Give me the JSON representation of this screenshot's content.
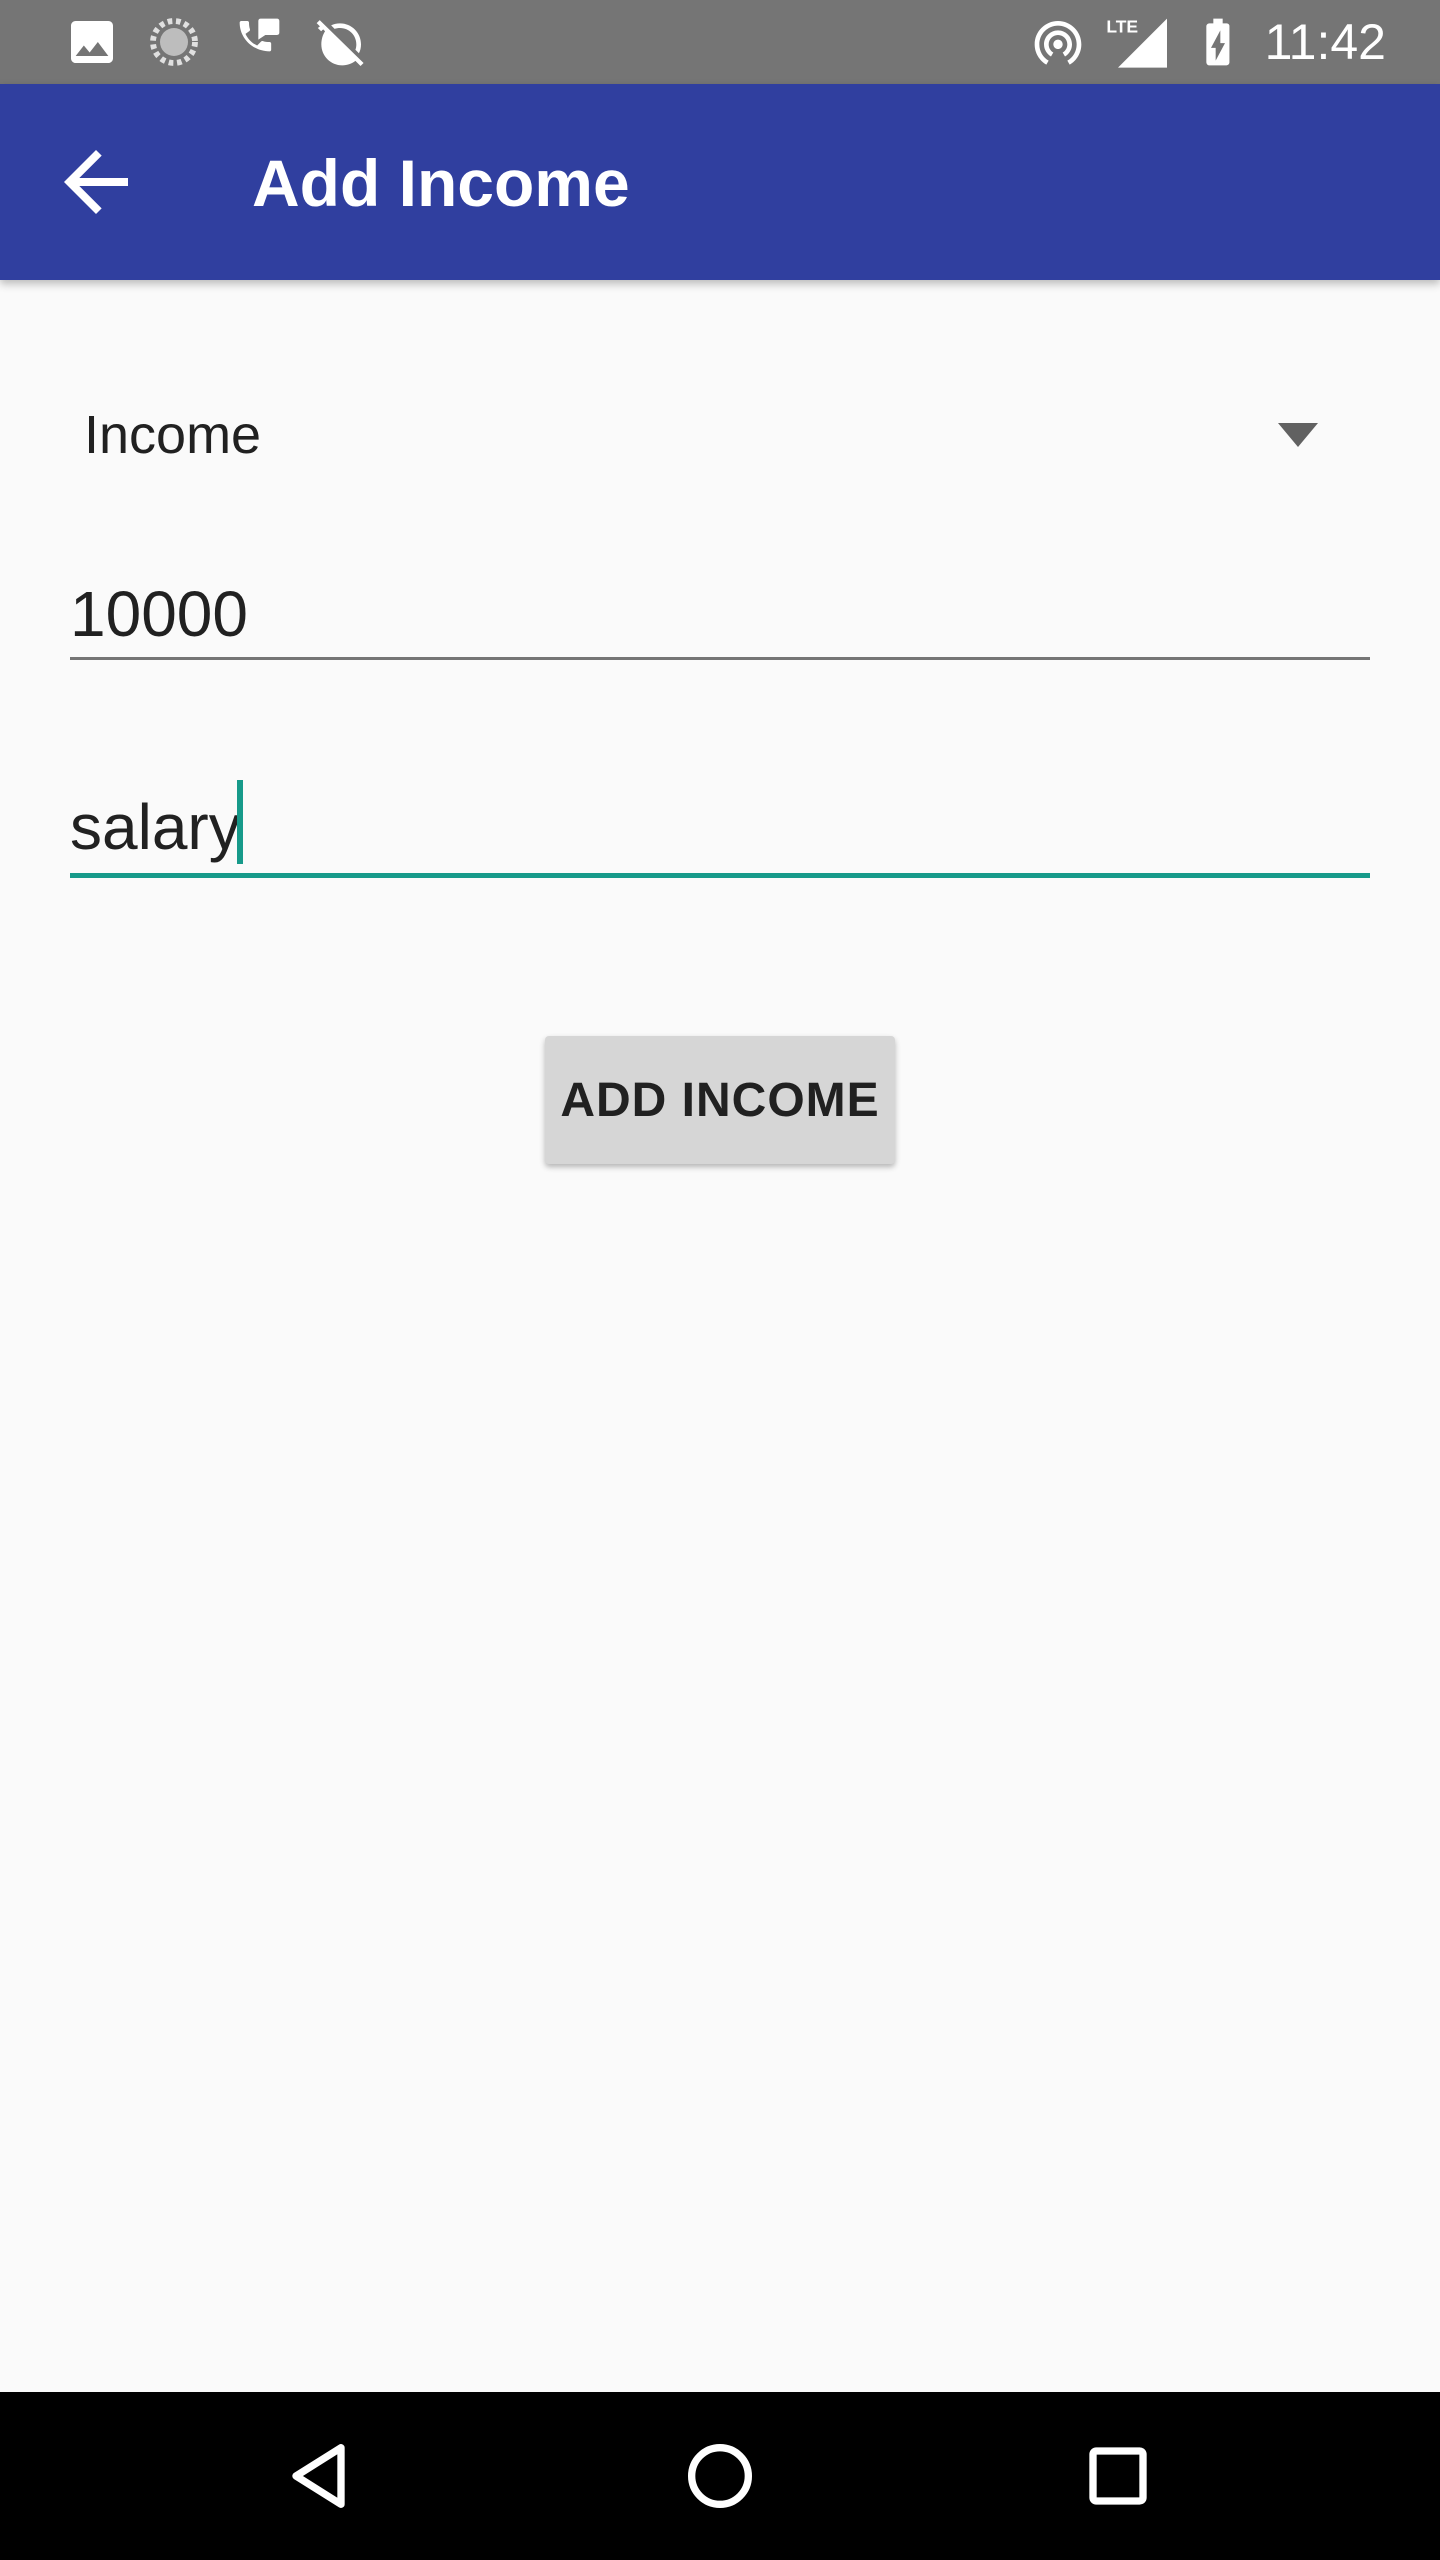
{
  "status_bar": {
    "time": "11:42",
    "left_icons": [
      "gallery-icon",
      "loading-icon",
      "call-chat-icon",
      "alarm-off-icon"
    ],
    "right_icons": [
      "hotspot-icon",
      "lte-signal-icon",
      "battery-charging-icon"
    ],
    "network_label": "LTE"
  },
  "app_bar": {
    "title": "Add Income",
    "background_color": "#303f9f"
  },
  "form": {
    "category_spinner": {
      "value": "Income"
    },
    "amount_field": {
      "value": "10000"
    },
    "note_field": {
      "value": "salary"
    },
    "accent_color": "#179a8a"
  },
  "actions": {
    "add_button_label": "ADD INCOME"
  },
  "nav_bar": {
    "buttons": [
      "back",
      "home",
      "recents"
    ]
  }
}
